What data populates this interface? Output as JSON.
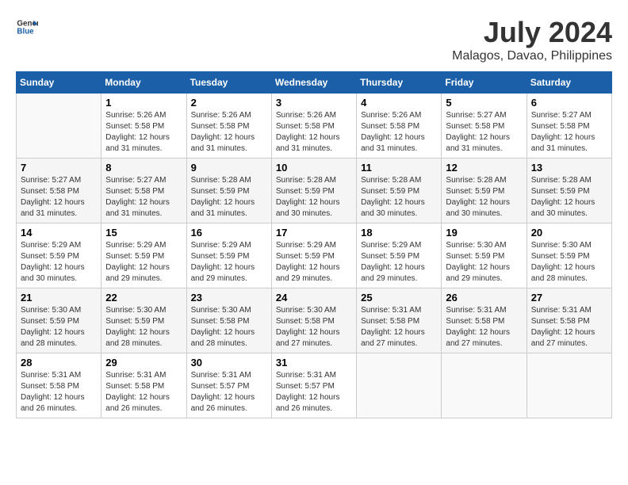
{
  "header": {
    "logo_line1": "General",
    "logo_line2": "Blue",
    "title": "July 2024",
    "subtitle": "Malagos, Davao, Philippines"
  },
  "weekdays": [
    "Sunday",
    "Monday",
    "Tuesday",
    "Wednesday",
    "Thursday",
    "Friday",
    "Saturday"
  ],
  "weeks": [
    [
      {
        "day": "",
        "sunrise": "",
        "sunset": "",
        "daylight": ""
      },
      {
        "day": "1",
        "sunrise": "Sunrise: 5:26 AM",
        "sunset": "Sunset: 5:58 PM",
        "daylight": "Daylight: 12 hours and 31 minutes."
      },
      {
        "day": "2",
        "sunrise": "Sunrise: 5:26 AM",
        "sunset": "Sunset: 5:58 PM",
        "daylight": "Daylight: 12 hours and 31 minutes."
      },
      {
        "day": "3",
        "sunrise": "Sunrise: 5:26 AM",
        "sunset": "Sunset: 5:58 PM",
        "daylight": "Daylight: 12 hours and 31 minutes."
      },
      {
        "day": "4",
        "sunrise": "Sunrise: 5:26 AM",
        "sunset": "Sunset: 5:58 PM",
        "daylight": "Daylight: 12 hours and 31 minutes."
      },
      {
        "day": "5",
        "sunrise": "Sunrise: 5:27 AM",
        "sunset": "Sunset: 5:58 PM",
        "daylight": "Daylight: 12 hours and 31 minutes."
      },
      {
        "day": "6",
        "sunrise": "Sunrise: 5:27 AM",
        "sunset": "Sunset: 5:58 PM",
        "daylight": "Daylight: 12 hours and 31 minutes."
      }
    ],
    [
      {
        "day": "7",
        "sunrise": "Sunrise: 5:27 AM",
        "sunset": "Sunset: 5:58 PM",
        "daylight": "Daylight: 12 hours and 31 minutes."
      },
      {
        "day": "8",
        "sunrise": "Sunrise: 5:27 AM",
        "sunset": "Sunset: 5:58 PM",
        "daylight": "Daylight: 12 hours and 31 minutes."
      },
      {
        "day": "9",
        "sunrise": "Sunrise: 5:28 AM",
        "sunset": "Sunset: 5:59 PM",
        "daylight": "Daylight: 12 hours and 31 minutes."
      },
      {
        "day": "10",
        "sunrise": "Sunrise: 5:28 AM",
        "sunset": "Sunset: 5:59 PM",
        "daylight": "Daylight: 12 hours and 30 minutes."
      },
      {
        "day": "11",
        "sunrise": "Sunrise: 5:28 AM",
        "sunset": "Sunset: 5:59 PM",
        "daylight": "Daylight: 12 hours and 30 minutes."
      },
      {
        "day": "12",
        "sunrise": "Sunrise: 5:28 AM",
        "sunset": "Sunset: 5:59 PM",
        "daylight": "Daylight: 12 hours and 30 minutes."
      },
      {
        "day": "13",
        "sunrise": "Sunrise: 5:28 AM",
        "sunset": "Sunset: 5:59 PM",
        "daylight": "Daylight: 12 hours and 30 minutes."
      }
    ],
    [
      {
        "day": "14",
        "sunrise": "Sunrise: 5:29 AM",
        "sunset": "Sunset: 5:59 PM",
        "daylight": "Daylight: 12 hours and 30 minutes."
      },
      {
        "day": "15",
        "sunrise": "Sunrise: 5:29 AM",
        "sunset": "Sunset: 5:59 PM",
        "daylight": "Daylight: 12 hours and 29 minutes."
      },
      {
        "day": "16",
        "sunrise": "Sunrise: 5:29 AM",
        "sunset": "Sunset: 5:59 PM",
        "daylight": "Daylight: 12 hours and 29 minutes."
      },
      {
        "day": "17",
        "sunrise": "Sunrise: 5:29 AM",
        "sunset": "Sunset: 5:59 PM",
        "daylight": "Daylight: 12 hours and 29 minutes."
      },
      {
        "day": "18",
        "sunrise": "Sunrise: 5:29 AM",
        "sunset": "Sunset: 5:59 PM",
        "daylight": "Daylight: 12 hours and 29 minutes."
      },
      {
        "day": "19",
        "sunrise": "Sunrise: 5:30 AM",
        "sunset": "Sunset: 5:59 PM",
        "daylight": "Daylight: 12 hours and 29 minutes."
      },
      {
        "day": "20",
        "sunrise": "Sunrise: 5:30 AM",
        "sunset": "Sunset: 5:59 PM",
        "daylight": "Daylight: 12 hours and 28 minutes."
      }
    ],
    [
      {
        "day": "21",
        "sunrise": "Sunrise: 5:30 AM",
        "sunset": "Sunset: 5:59 PM",
        "daylight": "Daylight: 12 hours and 28 minutes."
      },
      {
        "day": "22",
        "sunrise": "Sunrise: 5:30 AM",
        "sunset": "Sunset: 5:59 PM",
        "daylight": "Daylight: 12 hours and 28 minutes."
      },
      {
        "day": "23",
        "sunrise": "Sunrise: 5:30 AM",
        "sunset": "Sunset: 5:58 PM",
        "daylight": "Daylight: 12 hours and 28 minutes."
      },
      {
        "day": "24",
        "sunrise": "Sunrise: 5:30 AM",
        "sunset": "Sunset: 5:58 PM",
        "daylight": "Daylight: 12 hours and 27 minutes."
      },
      {
        "day": "25",
        "sunrise": "Sunrise: 5:31 AM",
        "sunset": "Sunset: 5:58 PM",
        "daylight": "Daylight: 12 hours and 27 minutes."
      },
      {
        "day": "26",
        "sunrise": "Sunrise: 5:31 AM",
        "sunset": "Sunset: 5:58 PM",
        "daylight": "Daylight: 12 hours and 27 minutes."
      },
      {
        "day": "27",
        "sunrise": "Sunrise: 5:31 AM",
        "sunset": "Sunset: 5:58 PM",
        "daylight": "Daylight: 12 hours and 27 minutes."
      }
    ],
    [
      {
        "day": "28",
        "sunrise": "Sunrise: 5:31 AM",
        "sunset": "Sunset: 5:58 PM",
        "daylight": "Daylight: 12 hours and 26 minutes."
      },
      {
        "day": "29",
        "sunrise": "Sunrise: 5:31 AM",
        "sunset": "Sunset: 5:58 PM",
        "daylight": "Daylight: 12 hours and 26 minutes."
      },
      {
        "day": "30",
        "sunrise": "Sunrise: 5:31 AM",
        "sunset": "Sunset: 5:57 PM",
        "daylight": "Daylight: 12 hours and 26 minutes."
      },
      {
        "day": "31",
        "sunrise": "Sunrise: 5:31 AM",
        "sunset": "Sunset: 5:57 PM",
        "daylight": "Daylight: 12 hours and 26 minutes."
      },
      {
        "day": "",
        "sunrise": "",
        "sunset": "",
        "daylight": ""
      },
      {
        "day": "",
        "sunrise": "",
        "sunset": "",
        "daylight": ""
      },
      {
        "day": "",
        "sunrise": "",
        "sunset": "",
        "daylight": ""
      }
    ]
  ]
}
